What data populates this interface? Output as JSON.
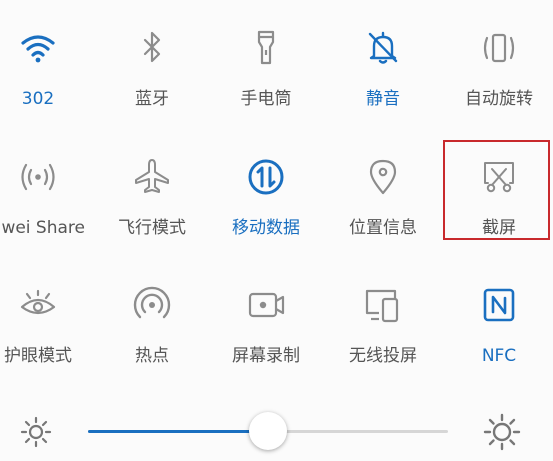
{
  "colors": {
    "active": "#1a6fc0",
    "inactive": "#888888",
    "highlight_box": "#c8292c"
  },
  "rows": [
    [
      {
        "label": "302",
        "icon": "wifi-icon",
        "active": true
      },
      {
        "label": "蓝牙",
        "icon": "bluetooth-icon",
        "active": false
      },
      {
        "label": "手电筒",
        "icon": "flashlight-icon",
        "active": false
      },
      {
        "label": "静音",
        "icon": "bell-off-icon",
        "active": true
      },
      {
        "label": "自动旋转",
        "icon": "auto-rotate-icon",
        "active": false
      }
    ],
    [
      {
        "label": "uawei Share",
        "icon": "huawei-share-icon",
        "active": false
      },
      {
        "label": "飞行模式",
        "icon": "airplane-icon",
        "active": false
      },
      {
        "label": "移动数据",
        "icon": "mobile-data-icon",
        "active": true
      },
      {
        "label": "位置信息",
        "icon": "location-icon",
        "active": false
      },
      {
        "label": "截屏",
        "icon": "screenshot-icon",
        "active": false
      }
    ],
    [
      {
        "label": "护眼模式",
        "icon": "eye-comfort-icon",
        "active": false
      },
      {
        "label": "热点",
        "icon": "hotspot-icon",
        "active": false
      },
      {
        "label": "屏幕录制",
        "icon": "screen-record-icon",
        "active": false
      },
      {
        "label": "无线投屏",
        "icon": "wireless-projection-icon",
        "active": false
      },
      {
        "label": "NFC",
        "icon": "nfc-icon",
        "active": true
      }
    ]
  ],
  "brightness": {
    "level": 0.5,
    "min_icon": "brightness-low-icon",
    "max_icon": "brightness-high-icon"
  }
}
